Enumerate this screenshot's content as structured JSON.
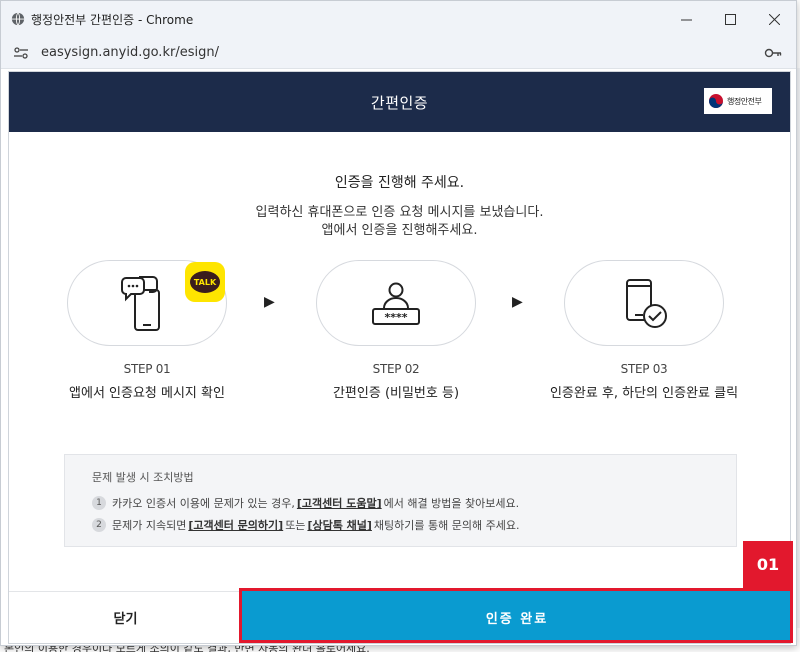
{
  "window": {
    "title": "행정안전부 간편인증 - Chrome",
    "url": "easysign.anyid.go.kr/esign/",
    "controls": [
      "minimize",
      "maximize",
      "close"
    ]
  },
  "dialog": {
    "title": "간편인증",
    "logo_text": "행정안전부",
    "intro": {
      "line1": "인증을 진행해 주세요.",
      "line2": "입력하신 휴대폰으로 인증 요청 메시지를 보냈습니다.",
      "line3": "앱에서 인증을 진행해주세요."
    },
    "steps": [
      {
        "num": "STEP 01",
        "desc": "앱에서 인증요청 메시지 확인",
        "icon": "phone-message-icon"
      },
      {
        "num": "STEP 02",
        "desc": "간편인증 (비밀번호 등)",
        "icon": "user-password-icon"
      },
      {
        "num": "STEP 03",
        "desc": "인증완료 후, 하단의 인증완료 클릭",
        "icon": "phone-check-icon"
      }
    ],
    "talk_badge": "TALK",
    "notice": {
      "title": "문제 발생 시 조치방법",
      "items": [
        {
          "num": "1",
          "pre": "카카오 인증서 이용에 문제가 있는 경우,",
          "link1": "[고객센터 도움말]",
          "post": "에서 해결 방법을 찾아보세요."
        },
        {
          "num": "2",
          "pre": "문제가 지속되면",
          "link1": "[고객센터 문의하기]",
          "mid": "또는",
          "link2": "[상담톡 채널]",
          "post": "채팅하기를 통해 문의해 주세요."
        }
      ]
    },
    "buttons": {
      "close": "닫기",
      "done": "인증 완료"
    }
  },
  "annotation": {
    "tag": "01",
    "color": "#e2182d"
  },
  "background": {
    "bottom_text": "본인의 이용한 경우이다 모르게 조의이 같도 결과, 반면 자동의 완녀 홀로어세요."
  },
  "colors": {
    "header_bg": "#1c2b4a",
    "done_btn": "#0a9bd0",
    "kakao_yellow": "#fee500"
  }
}
